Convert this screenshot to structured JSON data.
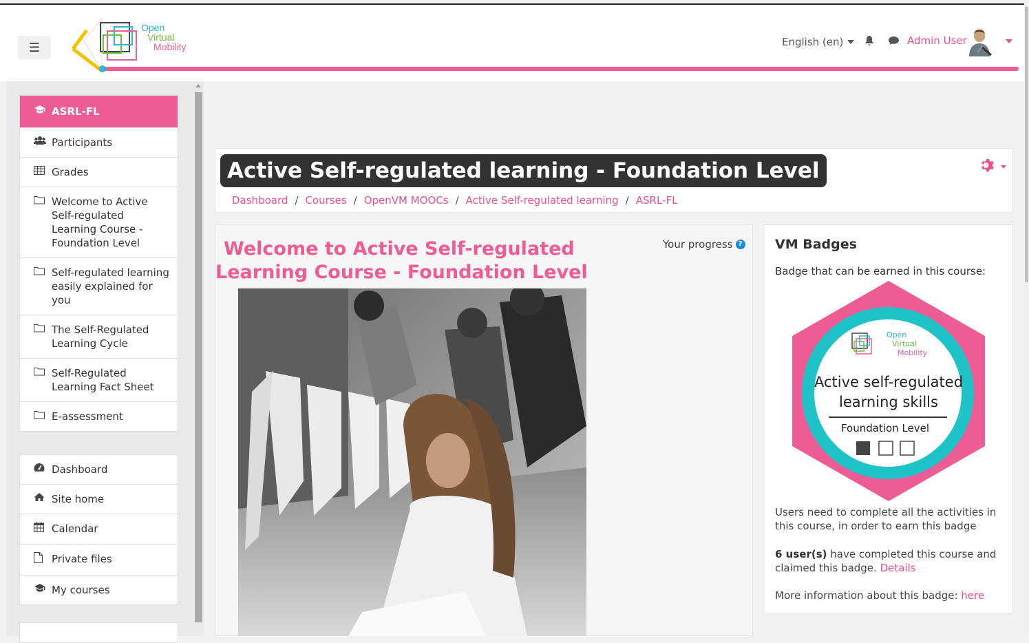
{
  "header": {
    "logo_lines": [
      "Open",
      "Virtual",
      "Mobility"
    ],
    "language": "English (en)",
    "user_name": "Admin User"
  },
  "sidebar": {
    "course_nav": [
      {
        "label": "ASRL-FL",
        "icon": "graduation-cap-icon",
        "active": true
      },
      {
        "label": "Participants",
        "icon": "users-icon"
      },
      {
        "label": "Grades",
        "icon": "table-icon"
      },
      {
        "label": "Welcome to Active Self-regulated Learning Course - Foundation Level",
        "icon": "folder-icon"
      },
      {
        "label": "Self-regulated learning easily explained for you",
        "icon": "folder-icon"
      },
      {
        "label": "The Self-Regulated Learning Cycle",
        "icon": "folder-icon"
      },
      {
        "label": "Self-Regulated Learning Fact Sheet",
        "icon": "folder-icon"
      },
      {
        "label": "E-assessment",
        "icon": "folder-icon"
      }
    ],
    "site_nav": [
      {
        "label": "Dashboard",
        "icon": "dashboard-icon"
      },
      {
        "label": "Site home",
        "icon": "home-icon"
      },
      {
        "label": "Calendar",
        "icon": "calendar-icon"
      },
      {
        "label": "Private files",
        "icon": "file-icon"
      },
      {
        "label": "My courses",
        "icon": "graduation-cap-icon"
      }
    ]
  },
  "page": {
    "title": "Active Self-regulated learning - Foundation Level",
    "breadcrumb": [
      "Dashboard",
      "Courses",
      "OpenVM MOOCs",
      "Active Self-regulated learning",
      "ASRL-FL"
    ]
  },
  "content": {
    "welcome_heading": "Welcome to Active Self-regulated Learning Course - Foundation Level",
    "progress_label": "Your progress"
  },
  "badges": {
    "title": "VM Badges",
    "subtitle": "Badge that can be earned in this course:",
    "badge_logo_lines": [
      "Open",
      "Virtual",
      "Mobility"
    ],
    "badge_name_line1": "Active self-regulated",
    "badge_name_line2": "learning skills",
    "badge_level": "Foundation Level",
    "requirement": "Users need to complete all the activities in this course, in order to earn this badge",
    "completed_count": "6 user(s)",
    "completed_text": " have completed this course and claimed this badge. ",
    "details_link": "Details",
    "more_info_text": "More information about this badge: ",
    "more_info_link": "here"
  },
  "colors": {
    "accent": "#ee5c96",
    "brand_blue": "#27b6d8"
  }
}
